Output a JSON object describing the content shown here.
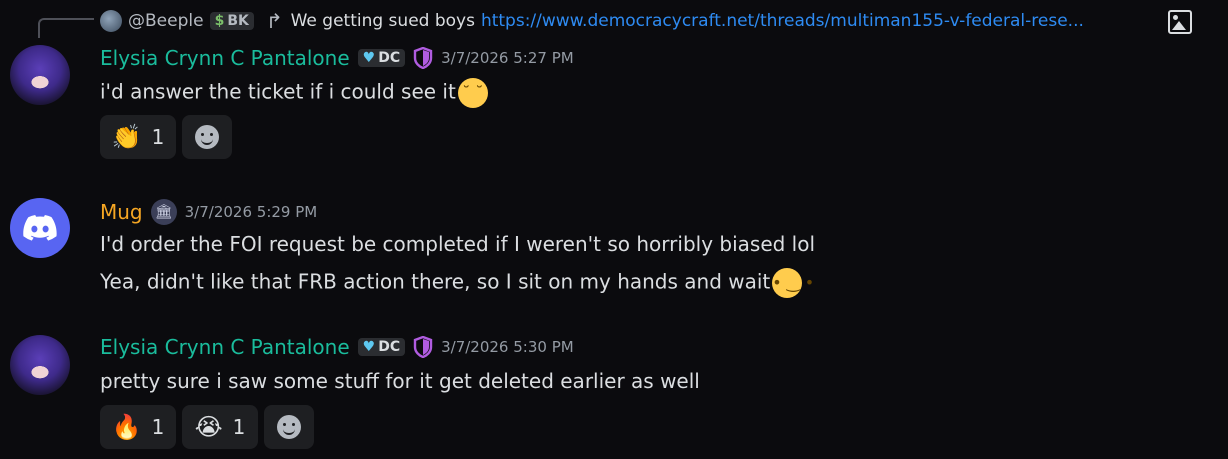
{
  "reply": {
    "author": "@Beeple",
    "tag": "BK",
    "text": "We getting sued boys",
    "link": "https://www.democracycraft.net/threads/multiman155-v-federal-rese..."
  },
  "messages": [
    {
      "author": "Elysia Crynn C Pantalone",
      "badge": "DC",
      "timestamp": "3/7/2026 5:27 PM",
      "lines": [
        "i'd answer the ticket if i could see it"
      ],
      "reactions": [
        {
          "emoji": "👏",
          "count": "1"
        }
      ]
    },
    {
      "author": "Mug",
      "timestamp": "3/7/2026 5:29 PM",
      "lines": [
        "I'd order the FOI request be completed if I weren't so horribly biased lol",
        "Yea, didn't like that FRB action there, so I sit on my hands and wait"
      ]
    },
    {
      "author": "Elysia Crynn C Pantalone",
      "badge": "DC",
      "timestamp": "3/7/2026 5:30 PM",
      "lines": [
        "pretty sure i saw some stuff for it get deleted earlier as well"
      ],
      "reactions": [
        {
          "emoji": "🔥",
          "count": "1"
        },
        {
          "emoji": "😭",
          "count": "1"
        }
      ]
    }
  ],
  "colors": {
    "elysia_name": "#1abc9c",
    "mug_name": "#f5a623",
    "link": "#2e8bf2",
    "background": "#0b0b0e"
  }
}
